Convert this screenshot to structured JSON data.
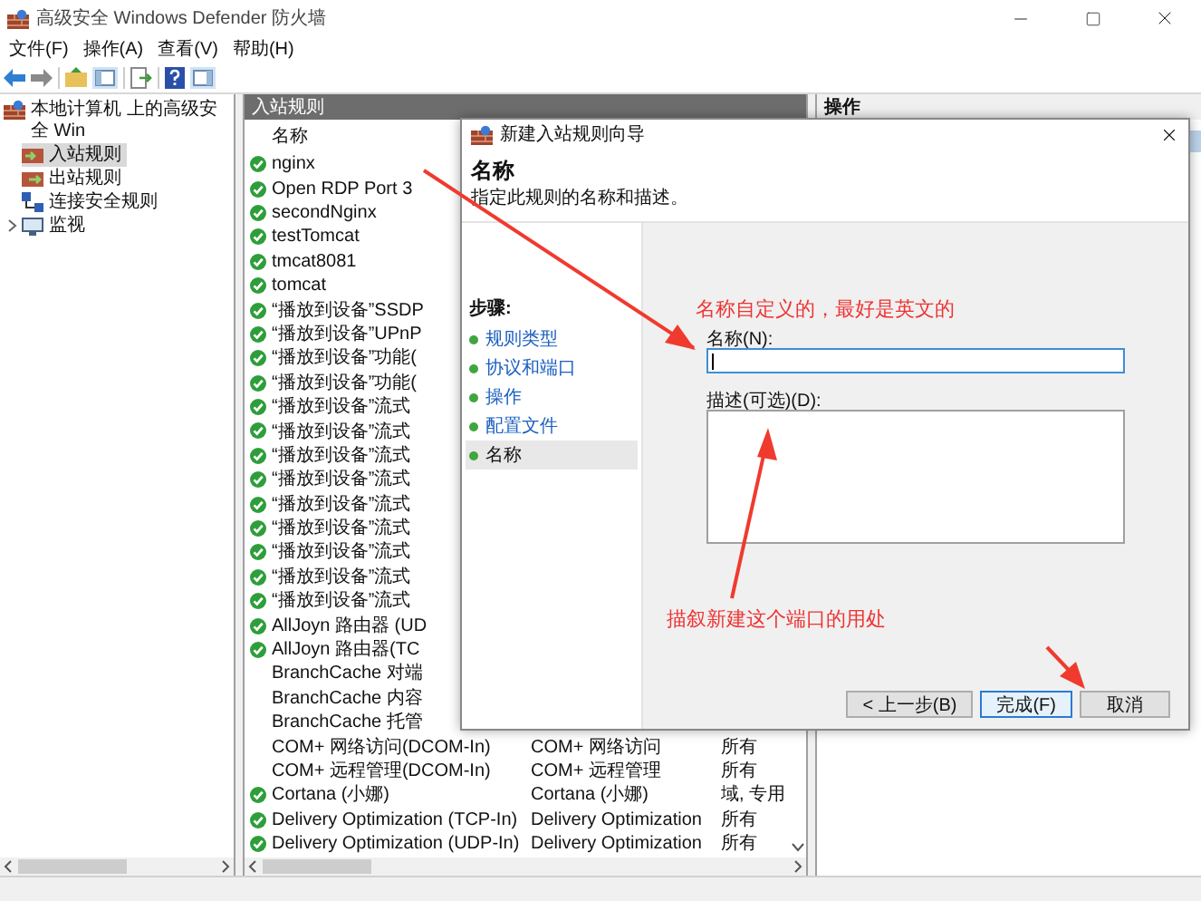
{
  "window": {
    "title": "高级安全 Windows Defender 防火墙"
  },
  "menu": [
    "文件(F)",
    "操作(A)",
    "查看(V)",
    "帮助(H)"
  ],
  "tree": {
    "label": "本地计算机 上的高级安全 Win",
    "children": [
      {
        "label": "入站规则",
        "kind": "inbound",
        "selected": true
      },
      {
        "label": "出站规则",
        "kind": "outbound",
        "selected": false
      },
      {
        "label": "连接安全规则",
        "kind": "connection",
        "selected": false
      },
      {
        "label": "监视",
        "kind": "monitor",
        "selected": false,
        "collapsed": true
      }
    ]
  },
  "rules": {
    "title": "入站规则",
    "columns": [
      "名称"
    ],
    "rows": [
      {
        "name": "nginx",
        "enabled": true
      },
      {
        "name": "Open RDP Port 3",
        "enabled": true
      },
      {
        "name": "secondNginx",
        "enabled": true
      },
      {
        "name": "testTomcat",
        "enabled": true
      },
      {
        "name": "tmcat8081",
        "enabled": true
      },
      {
        "name": "tomcat",
        "enabled": true
      },
      {
        "name": "“播放到设备”SSDP",
        "enabled": true
      },
      {
        "name": "“播放到设备”UPnP",
        "enabled": true
      },
      {
        "name": "“播放到设备”功能(",
        "enabled": true
      },
      {
        "name": "“播放到设备”功能(",
        "enabled": true
      },
      {
        "name": "“播放到设备”流式",
        "enabled": true
      },
      {
        "name": "“播放到设备”流式",
        "enabled": true
      },
      {
        "name": "“播放到设备”流式",
        "enabled": true
      },
      {
        "name": "“播放到设备”流式",
        "enabled": true
      },
      {
        "name": "“播放到设备”流式",
        "enabled": true
      },
      {
        "name": "“播放到设备”流式",
        "enabled": true
      },
      {
        "name": "“播放到设备”流式",
        "enabled": true
      },
      {
        "name": "“播放到设备”流式",
        "enabled": true
      },
      {
        "name": "“播放到设备”流式",
        "enabled": true
      },
      {
        "name": "AllJoyn 路由器 (UD",
        "enabled": true
      },
      {
        "name": "AllJoyn 路由器(TC",
        "enabled": true
      },
      {
        "name": "BranchCache 对端",
        "enabled": false
      },
      {
        "name": "BranchCache 内容",
        "enabled": false
      },
      {
        "name": "BranchCache 托管",
        "enabled": false
      },
      {
        "name": "COM+ 网络访问(DCOM-In)",
        "enabled": false,
        "group": "COM+ 网络访问",
        "profile": "所有"
      },
      {
        "name": "COM+ 远程管理(DCOM-In)",
        "enabled": false,
        "group": "COM+ 远程管理",
        "profile": "所有"
      },
      {
        "name": "Cortana (小娜)",
        "enabled": true,
        "group": "Cortana (小娜)",
        "profile": "域, 专用"
      },
      {
        "name": "Delivery Optimization (TCP-In)",
        "enabled": true,
        "group": "Delivery Optimization",
        "profile": "所有"
      },
      {
        "name": "Delivery Optimization (UDP-In)",
        "enabled": true,
        "group": "Delivery Optimization",
        "profile": "所有"
      }
    ]
  },
  "actions": {
    "title": "操作"
  },
  "dialog": {
    "title": "新建入站规则向导",
    "heading": "名称",
    "subtitle": "指定此规则的名称和描述。",
    "steps_label": "步骤:",
    "steps": [
      {
        "label": "规则类型",
        "selected": false
      },
      {
        "label": "协议和端口",
        "selected": false
      },
      {
        "label": "操作",
        "selected": false
      },
      {
        "label": "配置文件",
        "selected": false
      },
      {
        "label": "名称",
        "selected": true
      }
    ],
    "name_field": {
      "label": "名称(N):",
      "focused": true
    },
    "description_field": {
      "label": "描述(可选)(D):"
    },
    "buttons": [
      {
        "label": "< 上一步(B)",
        "default": false
      },
      {
        "label": "完成(F)",
        "default": true
      },
      {
        "label": "取消",
        "default": false
      }
    ]
  },
  "annotations": [
    {
      "text": "名称自定义的，最好是英文的"
    },
    {
      "text": "描叙新建这个端口的用处"
    }
  ]
}
